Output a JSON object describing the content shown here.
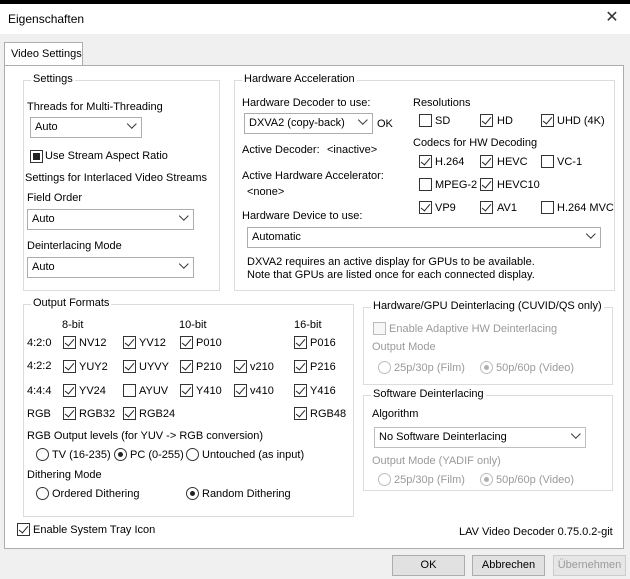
{
  "window": {
    "title": "Eigenschaften"
  },
  "tabs": [
    "Video Settings"
  ],
  "settings": {
    "title": "Settings",
    "threads_label": "Threads for Multi-Threading",
    "threads_value": "Auto",
    "stream_aspect_label": "Use Stream Aspect Ratio",
    "interlaced_title": "Settings for Interlaced Video Streams",
    "field_order_label": "Field Order",
    "field_order_value": "Auto",
    "deint_mode_label": "Deinterlacing Mode",
    "deint_mode_value": "Auto"
  },
  "hw": {
    "title": "Hardware Acceleration",
    "decoder_label": "Hardware Decoder to use:",
    "decoder_value": "DXVA2 (copy-back)",
    "ok": "OK",
    "active_decoder_label": "Active Decoder:",
    "active_decoder_value": "<inactive>",
    "active_accel_label": "Active Hardware Accelerator:",
    "active_accel_value": "<none>",
    "device_label": "Hardware Device to use:",
    "device_value": "Automatic",
    "note1": "DXVA2 requires an active display for GPUs to be available.",
    "note2": "Note that GPUs are listed once for each connected display.",
    "resolutions_title": "Resolutions",
    "res_sd": "SD",
    "res_hd": "HD",
    "res_uhd": "UHD (4K)",
    "codecs_title": "Codecs for HW Decoding",
    "c_h264": "H.264",
    "c_hevc": "HEVC",
    "c_vc1": "VC-1",
    "c_mpeg2": "MPEG-2",
    "c_hevc10": "HEVC10",
    "c_vp9": "VP9",
    "c_av1": "AV1",
    "c_h264mvc": "H.264 MVC"
  },
  "output": {
    "title": "Output Formats",
    "h_8bit": "8-bit",
    "h_10bit": "10-bit",
    "h_16bit": "16-bit",
    "r_420": "4:2:0",
    "r_422": "4:2:2",
    "r_444": "4:4:4",
    "r_rgb": "RGB",
    "nv12": "NV12",
    "yv12": "YV12",
    "p010": "P010",
    "p016": "P016",
    "yuy2": "YUY2",
    "uyvy": "UYVY",
    "p210": "P210",
    "v210": "v210",
    "p216": "P216",
    "yv24": "YV24",
    "ayuv": "AYUV",
    "y410": "Y410",
    "v410": "v410",
    "y416": "Y416",
    "rgb32": "RGB32",
    "rgb24": "RGB24",
    "rgb48": "RGB48",
    "levels_label": "RGB Output levels (for YUV -> RGB conversion)",
    "lv_tv": "TV (16-235)",
    "lv_pc": "PC (0-255)",
    "lv_untouched": "Untouched (as input)",
    "dither_label": "Dithering Mode",
    "d_ordered": "Ordered Dithering",
    "d_random": "Random Dithering"
  },
  "hwdeint": {
    "title": "Hardware/GPU Deinterlacing (CUVID/QS only)",
    "enable": "Enable Adaptive HW Deinterlacing",
    "mode_label": "Output Mode",
    "m25": "25p/30p (Film)",
    "m50": "50p/60p (Video)"
  },
  "swdeint": {
    "title": "Software Deinterlacing",
    "algo_label": "Algorithm",
    "algo_value": "No Software Deinterlacing",
    "mode_label": "Output Mode (YADIF only)",
    "m25": "25p/30p (Film)",
    "m50": "50p/60p (Video)"
  },
  "footer": {
    "tray": "Enable System Tray Icon",
    "version": "LAV Video Decoder 0.75.0.2-git",
    "ok": "OK",
    "cancel": "Abbrechen",
    "apply": "Übernehmen"
  }
}
